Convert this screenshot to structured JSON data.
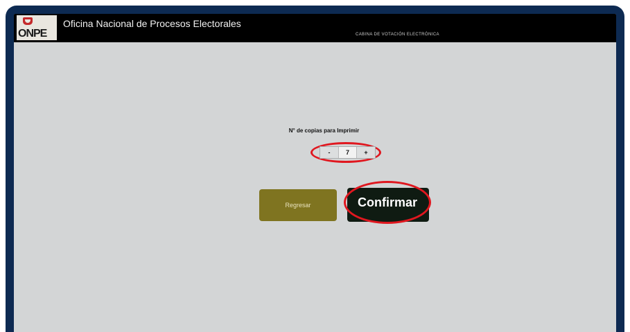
{
  "header": {
    "logo_text": "ONPE",
    "title": "Oficina Nacional de Procesos Electorales",
    "subtitle": "CABINA DE VOTACIÓN ELECTRÓNICA"
  },
  "copies": {
    "label": "N° de copias para Imprimir",
    "decrement_label": "-",
    "value": "7",
    "increment_label": "+"
  },
  "actions": {
    "back_label": "Regresar",
    "confirm_label": "Confirmar"
  },
  "colors": {
    "frame": "#0d2a52",
    "screen": "#d3d5d6",
    "header": "#000000",
    "back_button": "#7f7420",
    "confirm_button": "#0f1b12",
    "highlight_ring": "#e0171f"
  }
}
